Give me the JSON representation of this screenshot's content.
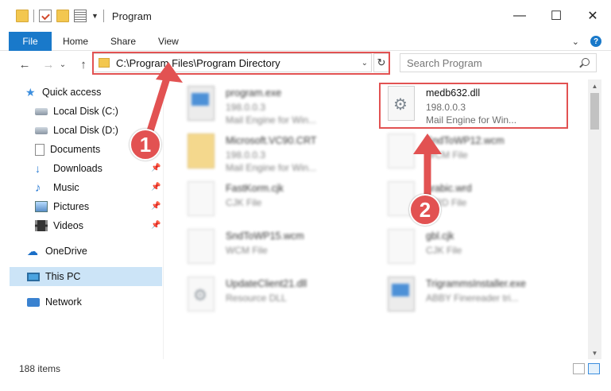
{
  "window": {
    "title": "Program",
    "minimize_glyph": "—",
    "maximize_glyph": "☐",
    "close_glyph": "✕"
  },
  "ribbon": {
    "tabs": [
      "File",
      "Home",
      "Share",
      "View"
    ],
    "help_glyph": "?",
    "expand_glyph": "⌄"
  },
  "nav": {
    "back_glyph": "←",
    "forward_glyph": "→",
    "dropdown_glyph": "⌄",
    "up_glyph": "↑",
    "address": "C:\\Program Files\\Program Directory",
    "address_dropdown_glyph": "⌄",
    "refresh_glyph": "↻",
    "search_placeholder": "Search Program"
  },
  "sidebar": {
    "items": [
      {
        "label": "Quick access",
        "icon": "star-icon"
      },
      {
        "label": "Local Disk (C:)",
        "icon": "disk-icon"
      },
      {
        "label": "Local Disk (D:)",
        "icon": "disk-icon"
      },
      {
        "label": "Documents",
        "icon": "document-icon"
      },
      {
        "label": "Downloads",
        "icon": "download-icon"
      },
      {
        "label": "Music",
        "icon": "music-icon"
      },
      {
        "label": "Pictures",
        "icon": "pictures-icon"
      },
      {
        "label": "Videos",
        "icon": "videos-icon"
      },
      {
        "label": "OneDrive",
        "icon": "cloud-icon"
      },
      {
        "label": "This PC",
        "icon": "pc-icon"
      },
      {
        "label": "Network",
        "icon": "network-icon"
      }
    ],
    "pin_glyph": "📌"
  },
  "files": [
    {
      "name": "program.exe",
      "line1": "198.0.0.3",
      "line2": "Mail Engine for Win..."
    },
    {
      "name": "medb632.dll",
      "line1": "198.0.0.3",
      "line2": "Mail Engine for Win..."
    },
    {
      "name": "Microsoft.VC90.CRT",
      "line1": "198.0.0.3",
      "line2": "Mail Engine for Win..."
    },
    {
      "name": "SndToWP12.wcm",
      "line1": "WCM File",
      "line2": ""
    },
    {
      "name": "FastKorm.cjk",
      "line1": "CJK File",
      "line2": ""
    },
    {
      "name": "arabic.wrd",
      "line1": "WRD File",
      "line2": ""
    },
    {
      "name": "SndToWP15.wcm",
      "line1": "WCM File",
      "line2": ""
    },
    {
      "name": "gbl.cjk",
      "line1": "CJK File",
      "line2": ""
    },
    {
      "name": "UpdateClient21.dll",
      "line1": "Resource DLL",
      "line2": ""
    },
    {
      "name": "TrigrammsInstaller.exe",
      "line1": "ABBY Finereader tri...",
      "line2": ""
    }
  ],
  "status": {
    "item_count": "188 items"
  },
  "annotations": {
    "marker1": "1",
    "marker2": "2",
    "highlight_color": "#e25252"
  },
  "colors": {
    "accent": "#1979ca",
    "selected": "#cce4f7"
  }
}
